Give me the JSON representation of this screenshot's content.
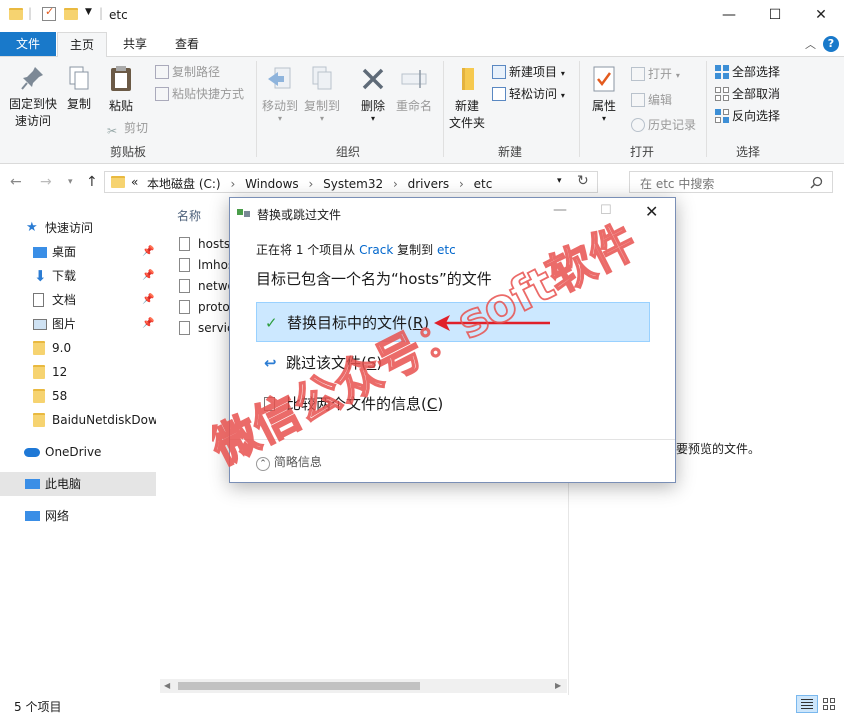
{
  "window": {
    "title": "etc",
    "minimize": "—",
    "maximize": "☐",
    "close": "✕"
  },
  "tabs": [
    "文件",
    "主页",
    "共享",
    "查看"
  ],
  "ribbon": {
    "clipboard": {
      "pin_line1": "固定到快",
      "pin_line2": "速访问",
      "copy": "复制",
      "paste": "粘贴",
      "copy_path": "复制路径",
      "paste_shortcut": "粘贴快捷方式",
      "cut": "剪切",
      "label": "剪贴板"
    },
    "organize": {
      "move_to": "移动到",
      "copy_to": "复制到",
      "delete": "删除",
      "rename": "重命名",
      "label": "组织"
    },
    "new": {
      "new_folder_line1": "新建",
      "new_folder_line2": "文件夹",
      "new_item": "新建项目",
      "easy_access": "轻松访问",
      "label": "新建"
    },
    "open": {
      "properties": "属性",
      "open": "打开",
      "edit": "编辑",
      "history": "历史记录",
      "label": "打开"
    },
    "select": {
      "select_all": "全部选择",
      "select_none": "全部取消",
      "invert": "反向选择",
      "label": "选择"
    }
  },
  "address": {
    "overflow": "«",
    "crumbs": [
      "本地磁盘 (C:)",
      "Windows",
      "System32",
      "drivers",
      "etc"
    ],
    "search_placeholder": "在 etc 中搜索"
  },
  "nav": {
    "quick_access": "快速访问",
    "items": [
      "桌面",
      "下载",
      "文档",
      "图片",
      "9.0",
      "12",
      "58",
      "BaiduNetdiskDow"
    ],
    "onedrive": "OneDrive",
    "this_pc": "此电脑",
    "network": "网络"
  },
  "file_list": {
    "column_name": "名称",
    "files": [
      "hosts",
      "lmhosts.sam",
      "networks",
      "protocol",
      "services"
    ]
  },
  "preview_text": "要预览的文件。",
  "status": {
    "count": "5 个项目"
  },
  "dialog": {
    "title": "替换或跳过文件",
    "progress_prefix": "正在将 1 个项目从",
    "source": "Crack",
    "progress_mid": "复制到",
    "dest": "etc",
    "heading": "目标已包含一个名为“hosts”的文件",
    "option_replace": "替换目标中的文件(",
    "option_replace_key": "R",
    "option_skip": "跳过该文件(",
    "option_skip_key": "S",
    "option_compare": "比较两个文件的信息(",
    "option_compare_key": "C",
    "close_paren": ")",
    "details": "简略信息"
  },
  "watermark": "微信公众号：soft软件",
  "colors": {
    "file_tab": "#1979ca",
    "link": "#0066cc",
    "selection": "#cce8ff",
    "watermark": "#e8524f",
    "arrow": "#e0202a"
  }
}
